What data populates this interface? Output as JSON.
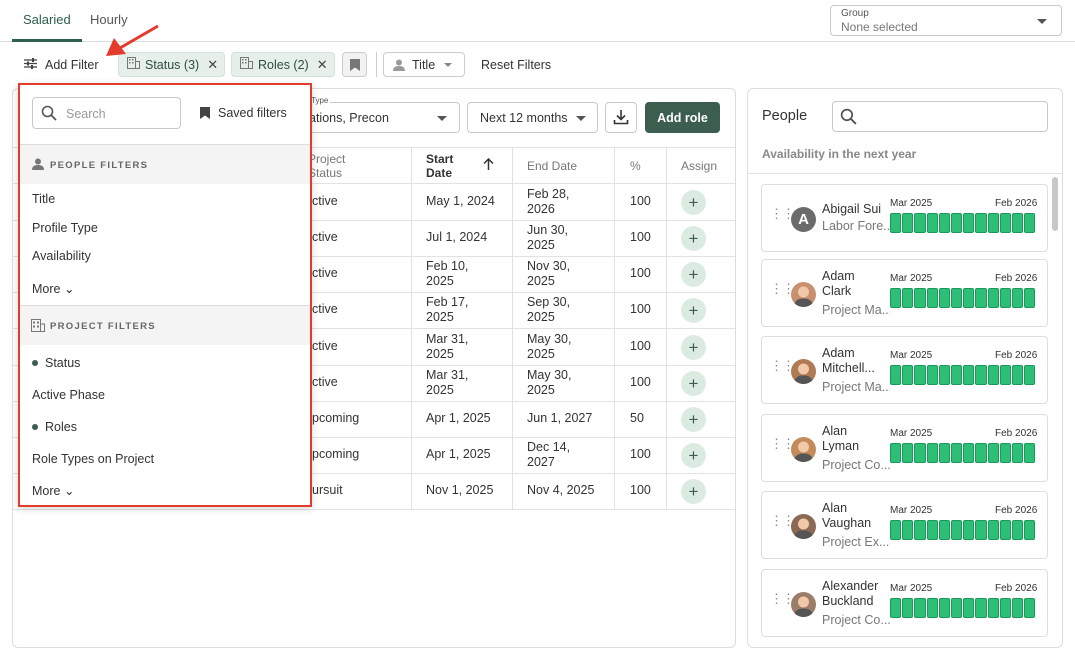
{
  "tabs": [
    {
      "label": "Salaried"
    },
    {
      "label": "Hourly"
    }
  ],
  "group": {
    "label": "Group",
    "value": "None selected"
  },
  "toolbar": {
    "add_filter": "Add Filter",
    "chips": [
      {
        "label": "Status (3)"
      },
      {
        "label": "Roles (2)"
      }
    ],
    "title_filter": "Title",
    "reset": "Reset Filters"
  },
  "controls": {
    "type_label": "Type",
    "type_value": "ations, Precon",
    "range_value": "Next 12 months",
    "add_role": "Add role"
  },
  "table": {
    "headers": {
      "status": "Project\nStatus",
      "start": "Start\nDate",
      "end": "End Date",
      "pct": "%",
      "assign": "Assign"
    },
    "rows": [
      {
        "status": "ctive",
        "start": "May 1, 2024",
        "end": "Feb 28,\n2026",
        "pct": "100"
      },
      {
        "status": "ctive",
        "start": "Jul 1, 2024",
        "end": "Jun 30,\n2025",
        "pct": "100"
      },
      {
        "status": "ctive",
        "start": "Feb 10,\n2025",
        "end": "Nov 30,\n2025",
        "pct": "100"
      },
      {
        "status": "ctive",
        "start": "Feb 17,\n2025",
        "end": "Sep 30,\n2025",
        "pct": "100"
      },
      {
        "status": "ctive",
        "start": "Mar 31,\n2025",
        "end": "May 30,\n2025",
        "pct": "100"
      },
      {
        "status": "ctive",
        "start": "Mar 31,\n2025",
        "end": "May 30,\n2025",
        "pct": "100"
      },
      {
        "status": "pcoming",
        "start": "Apr 1, 2025",
        "end": "Jun 1, 2027",
        "pct": "50"
      },
      {
        "status": "pcoming",
        "start": "Apr 1, 2025",
        "end": "Dec 14,\n2027",
        "pct": "100"
      },
      {
        "status": "ursuit",
        "start": "Nov 1, 2025",
        "end": "Nov 4, 2025",
        "pct": "100"
      }
    ]
  },
  "dropdown": {
    "search_placeholder": "Search",
    "saved_filters": "Saved filters",
    "people_header": "PEOPLE FILTERS",
    "people_items": [
      "Title",
      "Profile Type",
      "Availability"
    ],
    "more": "More",
    "project_header": "PROJECT FILTERS",
    "project_items": [
      "Status",
      "Active Phase",
      "Roles",
      "Role Types on Project"
    ]
  },
  "people": {
    "title": "People",
    "subtitle": "Availability in the next year",
    "start_label": "Mar 2025",
    "end_label": "Feb 2026",
    "list": [
      {
        "name": "Abigail Sui",
        "role": "Labor Fore...",
        "initial": "A"
      },
      {
        "name": "Adam\nClark",
        "role": "Project Ma..."
      },
      {
        "name": "Adam\nMitchell...",
        "role": "Project Ma..."
      },
      {
        "name": "Alan\nLyman",
        "role": "Project Co..."
      },
      {
        "name": "Alan\nVaughan",
        "role": "Project Ex..."
      },
      {
        "name": "Alexander\nBuckland",
        "role": "Project Co..."
      }
    ]
  },
  "colors": {
    "accent": "#3c5e50",
    "highlight": "#e53b2c",
    "bar": "#2dbf76"
  }
}
